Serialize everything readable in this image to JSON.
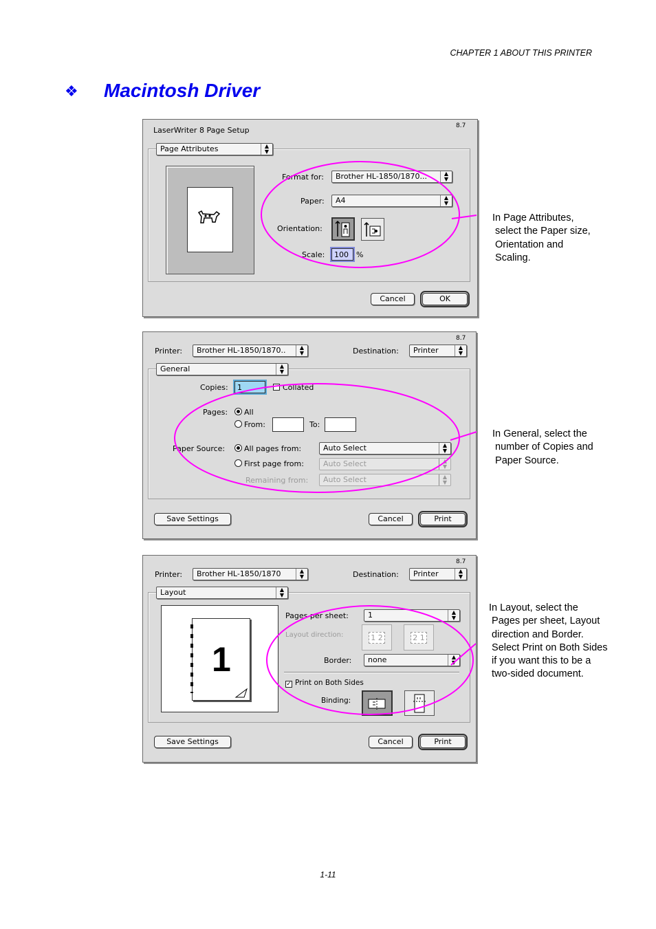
{
  "header": {
    "chapter": "CHAPTER 1 ABOUT THIS PRINTER"
  },
  "section": {
    "bullet": "❖",
    "title": "Macintosh Driver"
  },
  "page_setup": {
    "window_title": "LaserWriter 8 Page Setup",
    "version": "8.7",
    "panel_popup": "Page Attributes",
    "format_for_label": "Format for:",
    "format_for_value": "Brother HL-1850/1870...",
    "paper_label": "Paper:",
    "paper_value": "A4",
    "orientation_label": "Orientation:",
    "scale_label": "Scale:",
    "scale_value": "100",
    "scale_unit": "%",
    "cancel": "Cancel",
    "ok": "OK"
  },
  "print_general": {
    "version": "8.7",
    "printer_label": "Printer:",
    "printer_value": "Brother HL-1850/1870..",
    "destination_label": "Destination:",
    "destination_value": "Printer",
    "panel_popup": "General",
    "copies_label": "Copies:",
    "copies_value": "1",
    "collated_label": "Collated",
    "pages_label": "Pages:",
    "pages_all": "All",
    "pages_from": "From:",
    "pages_to": "To:",
    "paper_source_label": "Paper Source:",
    "all_pages_from": "All pages from:",
    "all_pages_value": "Auto Select",
    "first_page_from": "First page from:",
    "first_page_value": "Auto Select",
    "remaining_from": "Remaining from:",
    "remaining_value": "Auto Select",
    "save_settings": "Save Settings",
    "cancel": "Cancel",
    "print": "Print"
  },
  "print_layout": {
    "version": "8.7",
    "printer_label": "Printer:",
    "printer_value": "Brother HL-1850/1870",
    "destination_label": "Destination:",
    "destination_value": "Printer",
    "panel_popup": "Layout",
    "preview_number": "1",
    "pages_per_sheet_label": "Pages per sheet:",
    "pages_per_sheet_value": "1",
    "layout_direction_label": "Layout direction:",
    "dir_a": "1 2",
    "dir_b": "2 1",
    "border_label": "Border:",
    "border_value": "none",
    "both_sides_label": "Print on Both Sides",
    "binding_label": "Binding:",
    "save_settings": "Save Settings",
    "cancel": "Cancel",
    "print": "Print"
  },
  "notes": {
    "page_attributes": "In Page Attributes,\n select the Paper size,\n Orientation and\n Scaling.",
    "general": "In General, select the\n number of Copies and\n Paper Source.",
    "layout": "In Layout, select the\n Pages per sheet, Layout\n direction and Border.\n Select Print on Both Sides\n if you want this to be a\n two-sided document."
  },
  "colors": {
    "title": "#0000ee",
    "highlight_ellipse": "#ff00ff",
    "dialog_bg": "#dcdcdc"
  },
  "footer": {
    "page_number": "1-11"
  }
}
